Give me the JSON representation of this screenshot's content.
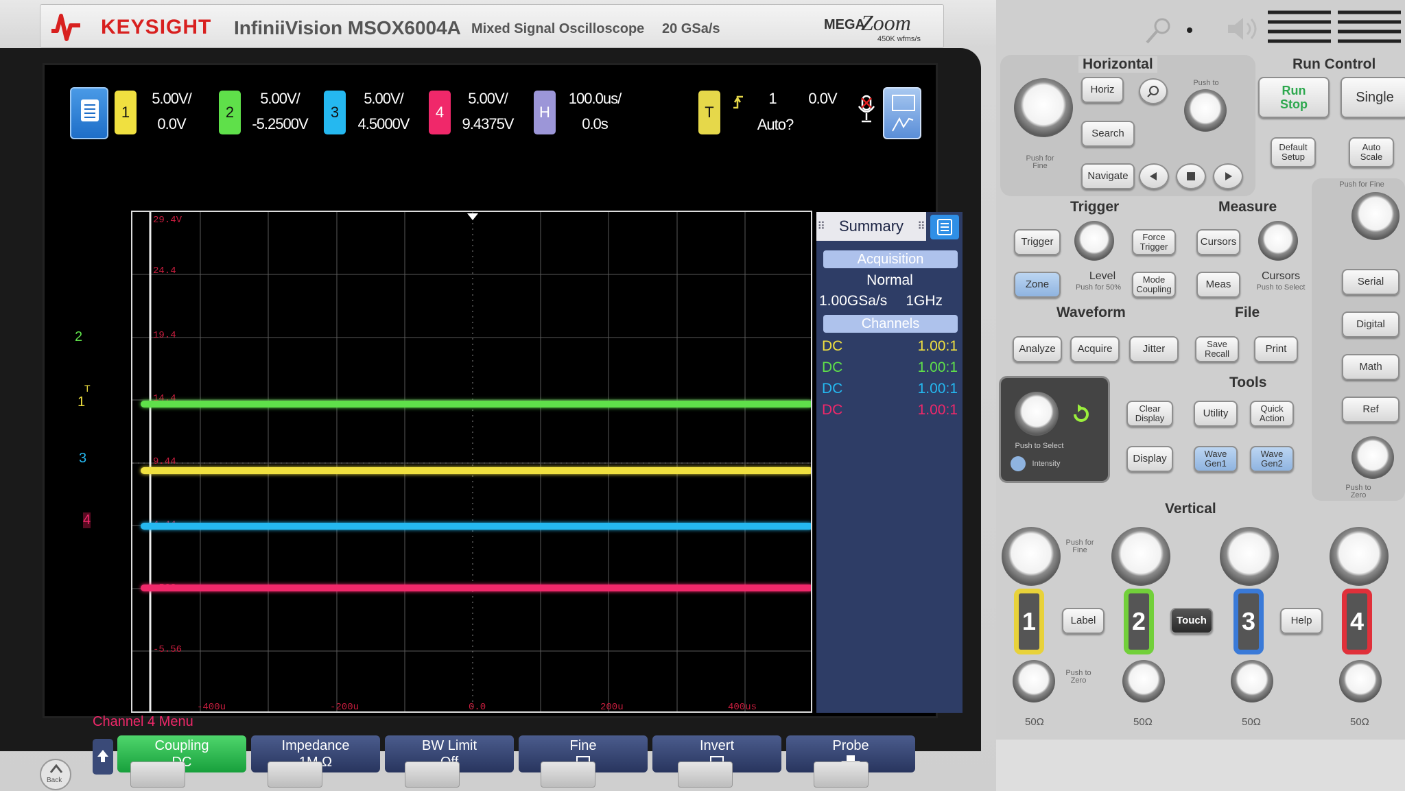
{
  "brand": {
    "name": "KEYSIGHT",
    "model": "InfiniiVision MSOX6004A",
    "type": "Mixed Signal Oscilloscope",
    "rate": "20 GSa/s",
    "mega": "MEGA",
    "zoom": "Zoom",
    "wfms": "450K wfms/s"
  },
  "colors": {
    "ch1": "#f0e040",
    "ch2": "#5fe04a",
    "ch3": "#25b8f0",
    "ch4": "#f0286a",
    "horiz": "#9c96d8",
    "trig": "#e6d84a",
    "run": "#39d06a"
  },
  "status": {
    "ch1": {
      "num": "1",
      "scale": "5.00V/",
      "offset": "0.0V"
    },
    "ch2": {
      "num": "2",
      "scale": "5.00V/",
      "offset": "-5.2500V"
    },
    "ch3": {
      "num": "3",
      "scale": "5.00V/",
      "offset": "4.5000V"
    },
    "ch4": {
      "num": "4",
      "scale": "5.00V/",
      "offset": "9.4375V"
    },
    "horiz": {
      "label": "H",
      "scale": "100.0us/",
      "delay": "0.0s"
    },
    "trig": {
      "label": "T",
      "source": "1",
      "level": "0.0V",
      "mode": "Auto?"
    }
  },
  "graticule": {
    "y_ticks": [
      "29.4V",
      "24.4",
      "19.4",
      "14.4",
      "9.44",
      "4.44",
      "-563m",
      "-5.56"
    ],
    "x_ticks": [
      "-400u",
      "-200u",
      "0.0",
      "200u",
      "400us"
    ],
    "markers": {
      "ch1": "1",
      "ch2": "2",
      "ch3": "3",
      "ch4": "4",
      "trig": "T"
    }
  },
  "summary": {
    "title": "Summary",
    "acq_header": "Acquisition",
    "acq_mode": "Normal",
    "sample_rate": "1.00GSa/s",
    "bandwidth": "1GHz",
    "channels_header": "Channels",
    "channels": [
      {
        "coupling": "DC",
        "probe": "1.00:1"
      },
      {
        "coupling": "DC",
        "probe": "1.00:1"
      },
      {
        "coupling": "DC",
        "probe": "1.00:1"
      },
      {
        "coupling": "DC",
        "probe": "1.00:1"
      }
    ]
  },
  "menu": {
    "title": "Channel 4 Menu",
    "softkeys": [
      {
        "label": "Coupling",
        "value": "DC"
      },
      {
        "label": "Impedance",
        "value": "1M Ω"
      },
      {
        "label": "BW Limit",
        "value": "Off"
      },
      {
        "label": "Fine",
        "value": ""
      },
      {
        "label": "Invert",
        "value": ""
      },
      {
        "label": "Probe",
        "value": ""
      }
    ]
  },
  "back_label": "Back",
  "panel": {
    "horizontal": {
      "title": "Horizontal",
      "horiz": "Horiz",
      "search": "Search",
      "navigate": "Navigate",
      "push_fine": "Push for Fine",
      "push_to": "Push to"
    },
    "run_control": {
      "title": "Run Control",
      "run": "Run",
      "stop": "Stop",
      "single": "Single",
      "default": "Default Setup",
      "auto": "Auto Scale"
    },
    "trigger": {
      "title": "Trigger",
      "trigger": "Trigger",
      "force": "Force Trigger",
      "zone": "Zone",
      "level": "Level",
      "level_sub": "Push for 50%",
      "mode": "Mode Coupling"
    },
    "measure": {
      "title": "Measure",
      "cursors": "Cursors",
      "meas": "Meas",
      "cursors_knob": "Cursors",
      "cursors_sub": "Push to Select"
    },
    "waveform": {
      "title": "Waveform",
      "analyze": "Analyze",
      "acquire": "Acquire",
      "jitter": "Jitter",
      "clear": "Clear Display",
      "display": "Display",
      "push_select": "Push to Select",
      "intensity": "Intensity"
    },
    "file": {
      "title": "File",
      "save": "Save Recall",
      "print": "Print"
    },
    "tools": {
      "title": "Tools",
      "utility": "Utility",
      "quick": "Quick Action",
      "wave1": "Wave Gen1",
      "wave2": "Wave Gen2"
    },
    "side": {
      "push_fine": "Push for Fine",
      "serial": "Serial",
      "digital": "Digital",
      "math": "Math",
      "ref": "Ref",
      "push_zero": "Push to Zero"
    },
    "vertical": {
      "title": "Vertical",
      "label": "Label",
      "touch": "Touch",
      "help": "Help",
      "ch": [
        "1",
        "2",
        "3",
        "4"
      ],
      "ohm": "50Ω",
      "push_fine": "Push for Fine",
      "push_zero": "Push to Zero"
    }
  }
}
